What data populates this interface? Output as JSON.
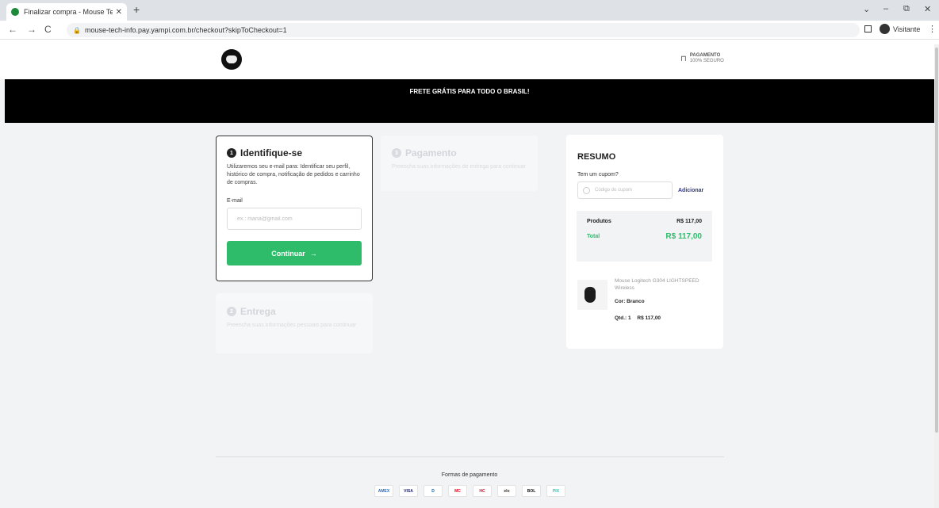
{
  "browser": {
    "tab_title": "Finalizar compra - Mouse Tech I",
    "tab_close": "✕",
    "new_tab": "+",
    "url": "mouse-tech-info.pay.yampi.com.br/checkout?skipToCheckout=1",
    "profile_label": "Visitante",
    "back": "←",
    "forward": "→",
    "reload": "C",
    "menu": "⋮",
    "win_min": "–",
    "win_restore": "⧉",
    "win_close": "✕",
    "win_chevron": "⌄"
  },
  "header": {
    "secure_line1": "PAGAMENTO",
    "secure_line2": "100% SEGURO"
  },
  "banner": {
    "text": "FRETE GRÁTIS PARA TODO O BRASIL!"
  },
  "steps": {
    "identify": {
      "number": "1",
      "title": "Identifique-se",
      "description": "Utilizaremos seu e-mail para: Identificar seu perfil, histórico de compra, notificação de pedidos e carrinho de compras.",
      "email_label": "E-mail",
      "email_placeholder": "ex.: maria@gmail.com",
      "continue_label": "Continuar",
      "continue_arrow": "→"
    },
    "payment": {
      "number": "3",
      "title": "Pagamento",
      "description": "Preencha suas informações de entrega para continuar"
    },
    "delivery": {
      "number": "2",
      "title": "Entrega",
      "description": "Preencha suas informações pessoais para continuar"
    }
  },
  "summary": {
    "title": "RESUMO",
    "coupon_question": "Tem um cupom?",
    "coupon_placeholder": "Código do cupom",
    "coupon_button": "Adicionar",
    "products_label": "Produtos",
    "products_value": "R$ 117,00",
    "total_label": "Total",
    "total_value": "R$ 117,00",
    "product": {
      "name": "Mouse Logitech G304 LIGHTSPEED Wireless",
      "color": "Cor: Branco",
      "qty": "Qtd.: 1",
      "price": "R$ 117,00"
    }
  },
  "footer": {
    "title": "Formas de pagamento",
    "payment_methods": [
      "AMEX",
      "VISA",
      "D",
      "MC",
      "HC",
      "elo",
      "BOL",
      "PIX"
    ]
  },
  "colors": {
    "accent_green": "#2ebc6b",
    "banner_bg": "#000000",
    "link_blue": "#333a8a"
  }
}
